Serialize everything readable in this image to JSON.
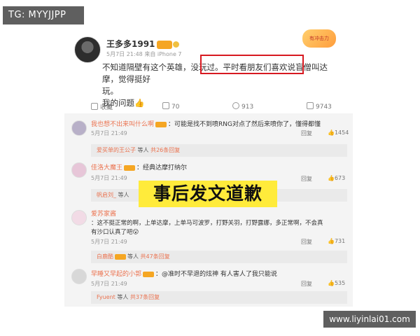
{
  "watermark_tg": "TG: MYYJJPP",
  "watermark_site": "www.liyinlai01.com",
  "post": {
    "author": "王多多1991",
    "meta": "5月7日 21:48 来自 iPhone 7",
    "corner_badge": "有冲击力",
    "text_line1": "不知道隔壁有这个英雄，没玩过。平时看朋友们喜欢说盲僧叫达摩，觉得挺好",
    "text_line2": "玩。",
    "text_line3": "我的问题",
    "actions": {
      "favorite": "收藏",
      "repost": "70",
      "comment": "913",
      "like": "9743"
    }
  },
  "comments": [
    {
      "user": "我也想不出来叫什么啊",
      "text": "：可能是找不到喷RNG对点了然后来喷你了，懂得都懂",
      "time": "5月7日 21:49",
      "reply_label": "回复",
      "likes": "1454",
      "replies": {
        "user": "爱买单的王公子",
        "suffix": "等人",
        "count": "共26条回复"
      }
    },
    {
      "user": "佳洛大魔王",
      "text": "：经典达摩打纳尔",
      "time": "5月7日 21:49",
      "reply_label": "回复",
      "likes": "673",
      "replies": {
        "user": "帆启刘_",
        "suffix": "等人",
        "count": ""
      }
    },
    {
      "user": "爱苏家酱",
      "text": "：这不挺正常的啊，上单达摩，上单马可波罗，打野关羽，打野露娜，多正常啊，不会真",
      "text2": "有沙口认真了吧",
      "time": "5月7日 21:49",
      "reply_label": "回复",
      "likes": "731",
      "replies": {
        "user": "白鹿酷",
        "suffix": "等人",
        "count": "共47条回复"
      }
    },
    {
      "user": "早睡又早起的小郭",
      "text": "：@准时不早退的炫神 有人害人了我只能说",
      "time": "5月7日 21:49",
      "reply_label": "回复",
      "likes": "535",
      "replies": {
        "user": "Fyuent",
        "suffix": "等人",
        "count": "共37条回复"
      }
    }
  ],
  "banner": "事后发文道歉",
  "colors": {
    "highlight": "#d71920",
    "banner_bg": "#ffeb3b",
    "username": "#eb7350"
  }
}
